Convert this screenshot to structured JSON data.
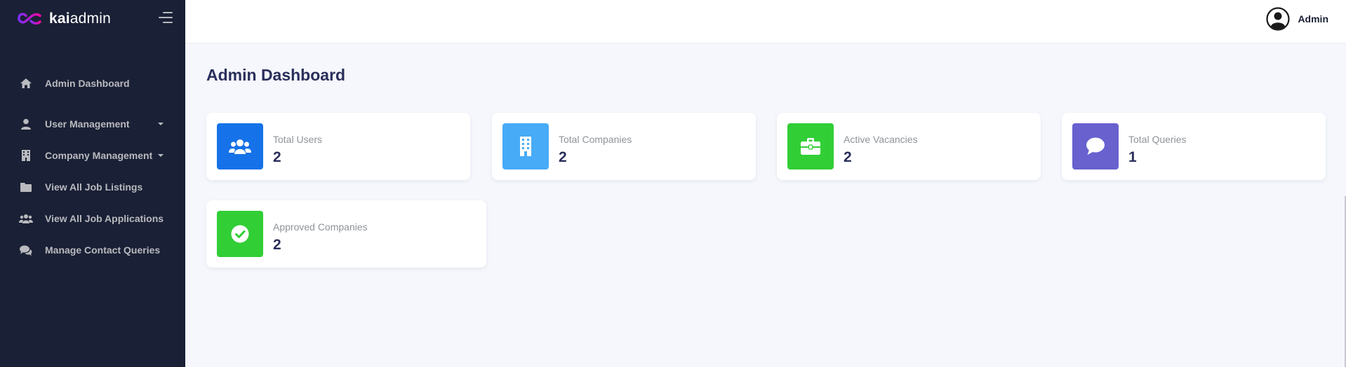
{
  "brand": {
    "bold": "kai",
    "light": "admin"
  },
  "sidebar": {
    "items": [
      {
        "label": "Admin Dashboard",
        "icon": "home-icon",
        "has_caret": false
      },
      {
        "label": "User Management",
        "icon": "user-icon",
        "has_caret": true
      },
      {
        "label": "Company Management",
        "icon": "building-icon",
        "has_caret": true
      },
      {
        "label": "View All Job Listings",
        "icon": "folder-icon",
        "has_caret": false
      },
      {
        "label": "View All Job Applications",
        "icon": "users-icon",
        "has_caret": false
      },
      {
        "label": "Manage Contact Queries",
        "icon": "comments-icon",
        "has_caret": false
      }
    ]
  },
  "header": {
    "user_name": "Admin"
  },
  "main": {
    "title": "Admin Dashboard",
    "cards": [
      {
        "label": "Total Users",
        "value": "2",
        "icon": "users-icon",
        "color": "#1572e8"
      },
      {
        "label": "Total Companies",
        "value": "2",
        "icon": "building-icon",
        "color": "#48abf7"
      },
      {
        "label": "Active Vacancies",
        "value": "2",
        "icon": "briefcase-icon",
        "color": "#31ce36"
      },
      {
        "label": "Total Queries",
        "value": "1",
        "icon": "comment-icon",
        "color": "#6861ce"
      },
      {
        "label": "Approved Companies",
        "value": "2",
        "icon": "check-circle-icon",
        "color": "#31ce36"
      }
    ]
  },
  "colors": {
    "sidebar_bg": "#1a2035",
    "content_bg": "#f5f7fd",
    "sidebar_text": "#b9babf"
  }
}
